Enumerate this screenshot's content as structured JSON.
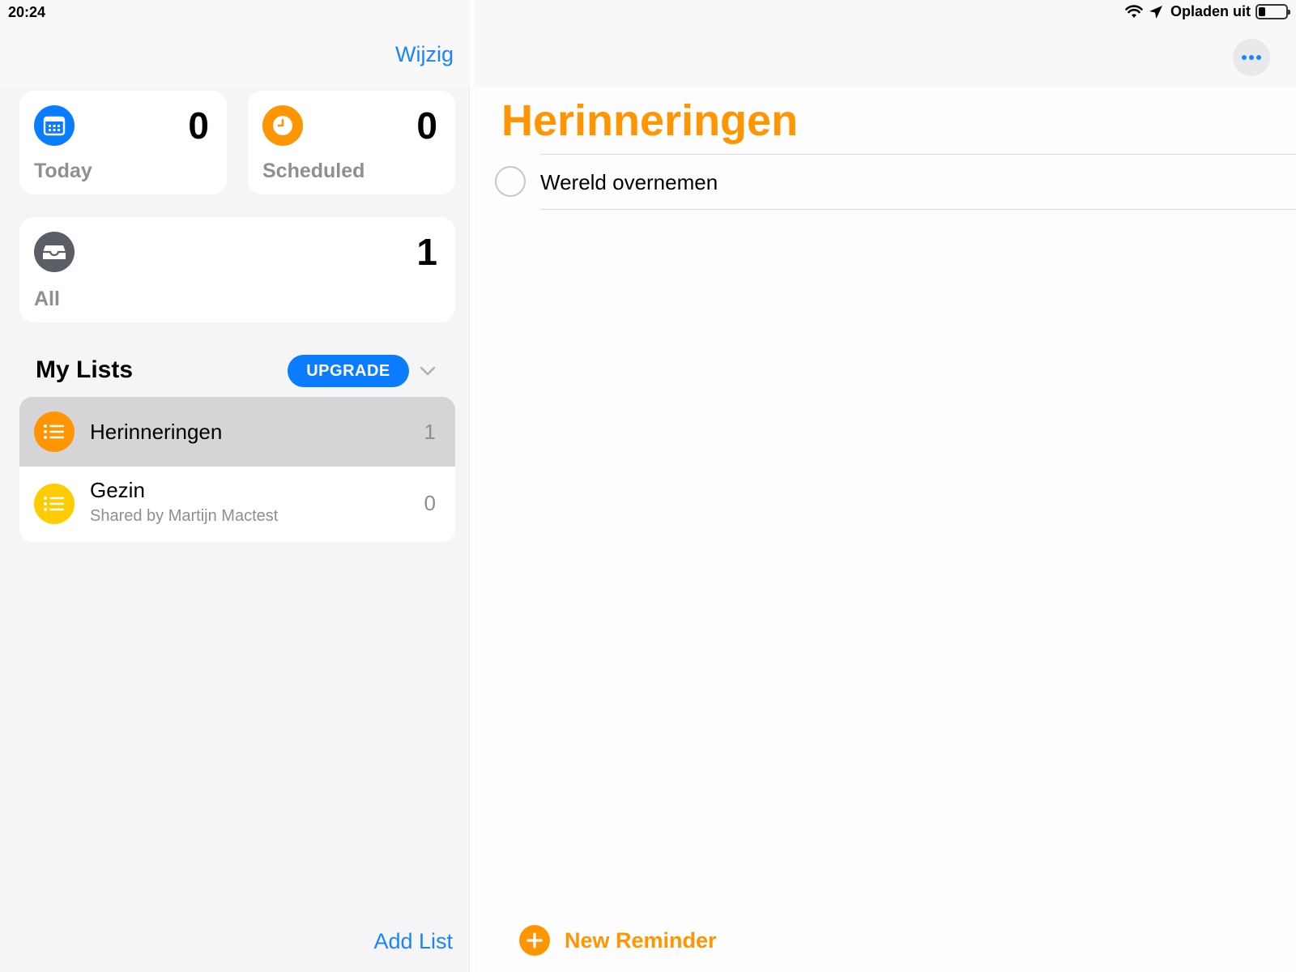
{
  "status_bar": {
    "time": "20:24",
    "charging_label": "Opladen uit"
  },
  "sidebar": {
    "edit_label": "Wijzig",
    "smart_lists": [
      {
        "label": "Today",
        "count": "0",
        "icon": "calendar-icon",
        "color": "#0a7cff"
      },
      {
        "label": "Scheduled",
        "count": "0",
        "icon": "clock-icon",
        "color": "#ff9500"
      },
      {
        "label": "All",
        "count": "1",
        "icon": "tray-icon",
        "color": "#5b5e64"
      }
    ],
    "my_lists_title": "My Lists",
    "upgrade_label": "UPGRADE",
    "lists": [
      {
        "name": "Herinneringen",
        "count": "1",
        "color": "#ff9500",
        "selected": true
      },
      {
        "name": "Gezin",
        "subtitle": "Shared by Martijn Mactest",
        "count": "0",
        "color": "#ffcc00",
        "selected": false
      }
    ],
    "add_list_label": "Add List"
  },
  "detail": {
    "title": "Herinneringen",
    "accent": "#ff9500",
    "reminders": [
      {
        "text": "Wereld overnemen",
        "completed": false
      }
    ],
    "new_reminder_label": "New Reminder"
  }
}
